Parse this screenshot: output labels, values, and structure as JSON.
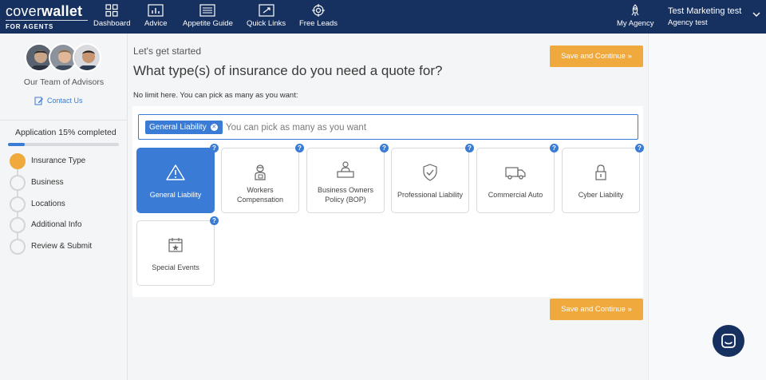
{
  "brand": {
    "logo_part1": "cover",
    "logo_part2": "wallet",
    "logo_sub": "FOR AGENTS"
  },
  "nav": {
    "items": [
      {
        "label": "Dashboard",
        "icon": "grid-icon"
      },
      {
        "label": "Advice",
        "icon": "bar-chart-icon"
      },
      {
        "label": "Appetite Guide",
        "icon": "list-icon"
      },
      {
        "label": "Quick Links",
        "icon": "link-icon"
      },
      {
        "label": "Free Leads",
        "icon": "target-icon"
      }
    ],
    "agency": {
      "label": "My Agency",
      "icon": "rocket-icon"
    },
    "user": {
      "name": "Test Marketing test",
      "company": "Agency test"
    }
  },
  "sidebar": {
    "team_label": "Our Team of Advisors",
    "contact_label": "Contact Us",
    "progress_label": "Application 15% completed",
    "progress_fraction": 0.15,
    "steps": [
      {
        "label": "Insurance Type",
        "active": true
      },
      {
        "label": "Business",
        "active": false
      },
      {
        "label": "Locations",
        "active": false
      },
      {
        "label": "Additional Info",
        "active": false
      },
      {
        "label": "Review & Submit",
        "active": false
      }
    ]
  },
  "main": {
    "lets_get_started": "Let's get started",
    "question": "What type(s) of insurance do you need a quote for?",
    "no_limit": "No limit here. You can pick as many as you want:",
    "save_label": "Save and Continue »",
    "selected_tag": "General Liability",
    "tag_placeholder": "You can pick as many as you want",
    "cards": [
      {
        "line1": "General Liability",
        "line2": "",
        "icon": "warning-icon",
        "selected": true
      },
      {
        "line1": "Workers",
        "line2": "Compensation",
        "icon": "worker-icon",
        "selected": false
      },
      {
        "line1": "Business Owners",
        "line2": "Policy (BOP)",
        "icon": "desk-icon",
        "selected": false
      },
      {
        "line1": "Professional Liability",
        "line2": "",
        "icon": "shield-check-icon",
        "selected": false
      },
      {
        "line1": "Commercial Auto",
        "line2": "",
        "icon": "truck-icon",
        "selected": false
      },
      {
        "line1": "Cyber Liability",
        "line2": "",
        "icon": "lock-icon",
        "selected": false
      },
      {
        "line1": "Special Events",
        "line2": "",
        "icon": "calendar-star-icon",
        "selected": false
      }
    ],
    "help_glyph": "?"
  },
  "colors": {
    "navy": "#16305f",
    "accent_blue": "#3a7bd5",
    "orange": "#f0a93c"
  }
}
